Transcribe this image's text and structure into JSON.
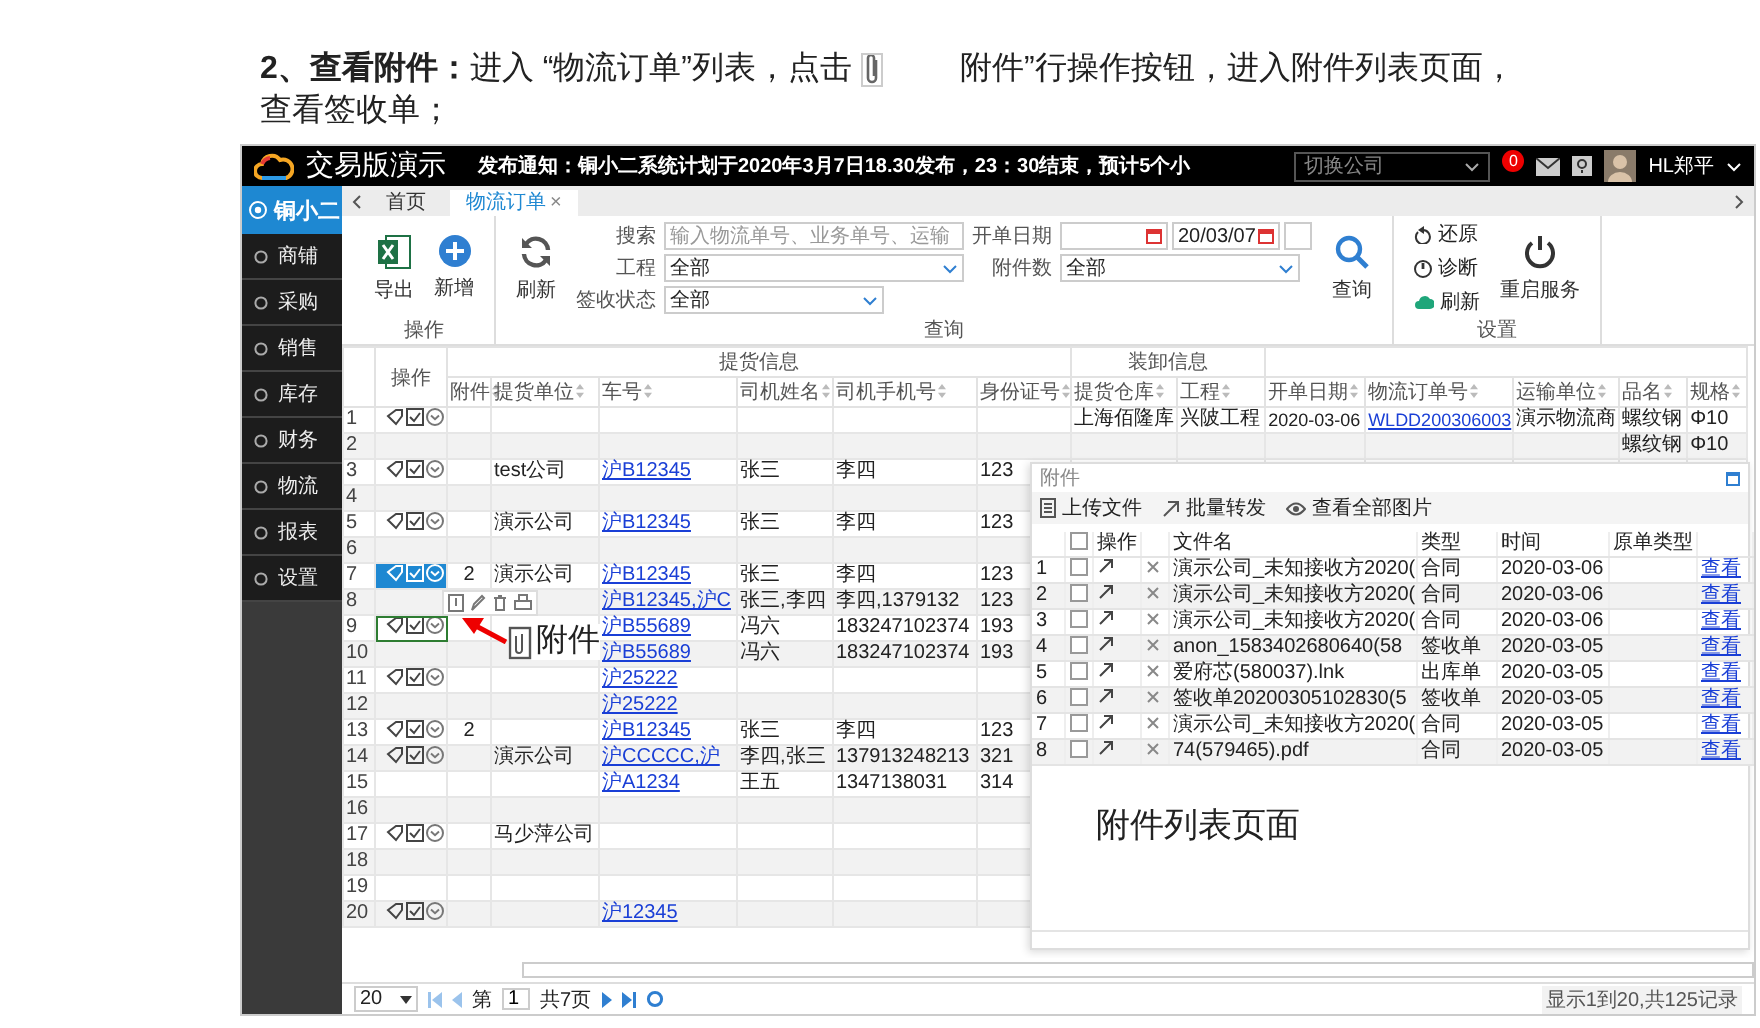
{
  "instruction": {
    "before": "**2、查看附件：**进入 “物流订单”列表，点击",
    "after": "附件”行操作按钮，进入附件列表页面，",
    "tail": "查看签收单；"
  },
  "app": {
    "logo": "交易版演示",
    "notice": "发布通知：铜小二系统计划于2020年3月7日18.30发布，23：30结束，预计5个小",
    "company_select": {
      "placeholder": "切换公司"
    },
    "badge": "0",
    "user": "HL郑平"
  },
  "sidebar": {
    "title": "铜小二",
    "items": [
      {
        "label": "商铺"
      },
      {
        "label": "采购"
      },
      {
        "label": "销售"
      },
      {
        "label": "库存"
      },
      {
        "label": "财务"
      },
      {
        "label": "物流"
      },
      {
        "label": "报表"
      },
      {
        "label": "设置"
      }
    ]
  },
  "tabs": [
    {
      "label": "首页",
      "selected": false
    },
    {
      "label": "物流订单",
      "selected": true,
      "close": "×"
    }
  ],
  "toolbar": {
    "groups": [
      {
        "title": "操作",
        "kind": "buttons",
        "buttons": [
          {
            "label": "导出",
            "kind": "excel"
          },
          {
            "label": "新增",
            "kind": "add"
          }
        ]
      },
      {
        "title": "查询",
        "kind": "query",
        "buttons": [
          {
            "label": "刷新",
            "kind": "refresh"
          }
        ],
        "search": {
          "label": "搜索",
          "placeholder": "输入物流单号、业务单号、运输"
        },
        "project": {
          "label": "工程",
          "value": "全部"
        },
        "sign": {
          "label": "签收状态",
          "value": "全部"
        },
        "date": {
          "label": "开单日期",
          "to": "20/03/07"
        },
        "attachments": {
          "label": "附件数",
          "value": "全部"
        },
        "submit": {
          "label": "查询",
          "kind": "search"
        }
      },
      {
        "title": "设置",
        "kind": "settings",
        "links": [
          {
            "label": "还原",
            "kind": "restore"
          },
          {
            "label": "诊断",
            "kind": "diagnose"
          },
          {
            "label": "刷新",
            "kind": "cloud"
          }
        ],
        "buttons": [
          {
            "label": "重启服务",
            "kind": "power"
          }
        ]
      }
    ]
  },
  "table": {
    "actions_header": "操作",
    "groups": [
      {
        "label": "提货信息",
        "columns": [
          {
            "label": "附件",
            "kind": "text"
          },
          {
            "label": "提货单位",
            "kind": "text"
          },
          {
            "label": "车号",
            "kind": "link"
          },
          {
            "label": "司机姓名",
            "kind": "text"
          },
          {
            "label": "司机手机号",
            "kind": "text"
          },
          {
            "label": "身份证号",
            "kind": "text"
          }
        ]
      },
      {
        "label": "装卸信息",
        "columns": [
          {
            "label": "提货仓库",
            "kind": "text"
          },
          {
            "label": "工程",
            "kind": "text"
          }
        ]
      },
      {
        "columns": [
          {
            "label": "开单日期",
            "kind": "text"
          },
          {
            "label": "物流订单号",
            "kind": "link"
          },
          {
            "label": "运输单位",
            "kind": "text"
          },
          {
            "label": "品名",
            "kind": "text"
          },
          {
            "label": "规格",
            "kind": "text"
          }
        ]
      }
    ],
    "rows": [
      {
        "n": "1",
        "actions": true,
        "hovered": false,
        "focused": false,
        "cells": [
          null,
          null,
          null,
          null,
          null,
          null,
          "上海佰隆库",
          "兴陂工程",
          "2020-03-06",
          "WLDD200306003",
          "演示物流商",
          "螺纹钢",
          "Φ10"
        ]
      },
      {
        "n": "2",
        "actions": false,
        "hovered": false,
        "focused": false,
        "cells": [
          null,
          null,
          null,
          null,
          null,
          null,
          null,
          null,
          null,
          null,
          null,
          "螺纹钢",
          "Φ10"
        ]
      },
      {
        "n": "3",
        "actions": true,
        "hovered": false,
        "focused": false,
        "cells": [
          null,
          "test公司",
          "沪B12345",
          "张三",
          "李四",
          "123"
        ]
      },
      {
        "n": "4",
        "actions": false,
        "hovered": false,
        "focused": false,
        "cells": []
      },
      {
        "n": "5",
        "actions": true,
        "hovered": false,
        "focused": false,
        "cells": [
          null,
          "演示公司",
          "沪B12345",
          "张三",
          "李四",
          "123"
        ]
      },
      {
        "n": "6",
        "actions": false,
        "hovered": false,
        "focused": false,
        "cells": []
      },
      {
        "n": "7",
        "actions": true,
        "hovered": true,
        "focused": false,
        "cells": [
          "2",
          "演示公司",
          "沪B12345",
          "张三",
          "李四",
          "123"
        ]
      },
      {
        "n": "8",
        "actions": false,
        "hovered": false,
        "focused": false,
        "cells": [
          null,
          null,
          "沪B12345,沪C",
          "张三,李四",
          "李四,1379132",
          "123"
        ]
      },
      {
        "n": "9",
        "actions": true,
        "hovered": false,
        "focused": true,
        "cells": [
          null,
          null,
          "沪B55689",
          "冯六",
          "183247102374",
          "193"
        ]
      },
      {
        "n": "10",
        "actions": false,
        "hovered": false,
        "focused": false,
        "cells": [
          null,
          null,
          "沪B55689",
          "冯六",
          "183247102374",
          "193"
        ]
      },
      {
        "n": "11",
        "actions": true,
        "hovered": false,
        "focused": false,
        "cells": [
          null,
          null,
          "沪25222"
        ]
      },
      {
        "n": "12",
        "actions": false,
        "hovered": false,
        "focused": false,
        "cells": [
          null,
          null,
          "沪25222"
        ]
      },
      {
        "n": "13",
        "actions": true,
        "hovered": false,
        "focused": false,
        "cells": [
          "2",
          null,
          "沪B12345",
          "张三",
          "李四",
          "123"
        ]
      },
      {
        "n": "14",
        "actions": true,
        "hovered": false,
        "focused": false,
        "cells": [
          null,
          "演示公司",
          "沪CCCCC,沪",
          "李四,张三",
          "137913248213",
          "321"
        ]
      },
      {
        "n": "15",
        "actions": false,
        "hovered": false,
        "focused": false,
        "cells": [
          null,
          null,
          "沪A1234",
          "王五",
          "1347138031",
          "314"
        ]
      },
      {
        "n": "16",
        "actions": false,
        "hovered": false,
        "focused": false,
        "cells": []
      },
      {
        "n": "17",
        "actions": true,
        "hovered": false,
        "focused": false,
        "cells": [
          null,
          "马少萍公司"
        ]
      },
      {
        "n": "18",
        "actions": false,
        "hovered": false,
        "focused": false,
        "cells": []
      },
      {
        "n": "19",
        "actions": false,
        "hovered": false,
        "focused": false,
        "cells": []
      },
      {
        "n": "20",
        "actions": true,
        "hovered": false,
        "focused": false,
        "cells": [
          null,
          null,
          "沪12345"
        ]
      }
    ]
  },
  "annotations": {
    "attachment_label": "附件",
    "dialog_label": "附件列表页面"
  },
  "attachment_dialog": {
    "title": "附件",
    "toolbar": [
      {
        "label": "上传文件",
        "kind": "upload"
      },
      {
        "label": "批量转发",
        "kind": "forward"
      },
      {
        "label": "查看全部图片",
        "kind": "view"
      }
    ],
    "header_checked": false,
    "columns": [
      "操作",
      "文件名",
      "类型",
      "时间",
      "原单类型"
    ],
    "rows": [
      {
        "n": "1",
        "checked": false,
        "file": "演示公司_未知接收方2020(",
        "type": "合同",
        "time": "2020-03-06",
        "link": "查看"
      },
      {
        "n": "2",
        "checked": false,
        "file": "演示公司_未知接收方2020(",
        "type": "合同",
        "time": "2020-03-06",
        "link": "查看"
      },
      {
        "n": "3",
        "checked": false,
        "file": "演示公司_未知接收方2020(",
        "type": "合同",
        "time": "2020-03-06",
        "link": "查看"
      },
      {
        "n": "4",
        "checked": false,
        "file": "anon_1583402680640(58",
        "type": "签收单",
        "time": "2020-03-05",
        "link": "查看"
      },
      {
        "n": "5",
        "checked": false,
        "file": "爱府芯(580037).lnk",
        "type": "出库单",
        "time": "2020-03-05",
        "link": "查看"
      },
      {
        "n": "6",
        "checked": false,
        "file": "签收单20200305102830(5",
        "type": "签收单",
        "time": "2020-03-05",
        "link": "查看"
      },
      {
        "n": "7",
        "checked": false,
        "file": "演示公司_未知接收方2020(",
        "type": "合同",
        "time": "2020-03-05",
        "link": "查看"
      },
      {
        "n": "8",
        "checked": false,
        "file": "74(579465).pdf",
        "type": "合同",
        "time": "2020-03-05",
        "link": "查看"
      }
    ]
  },
  "pager": {
    "page_size": "20",
    "page_prefix": "第",
    "page": "1",
    "page_total": "共7页",
    "summary": "显示1到20,共125记录"
  }
}
